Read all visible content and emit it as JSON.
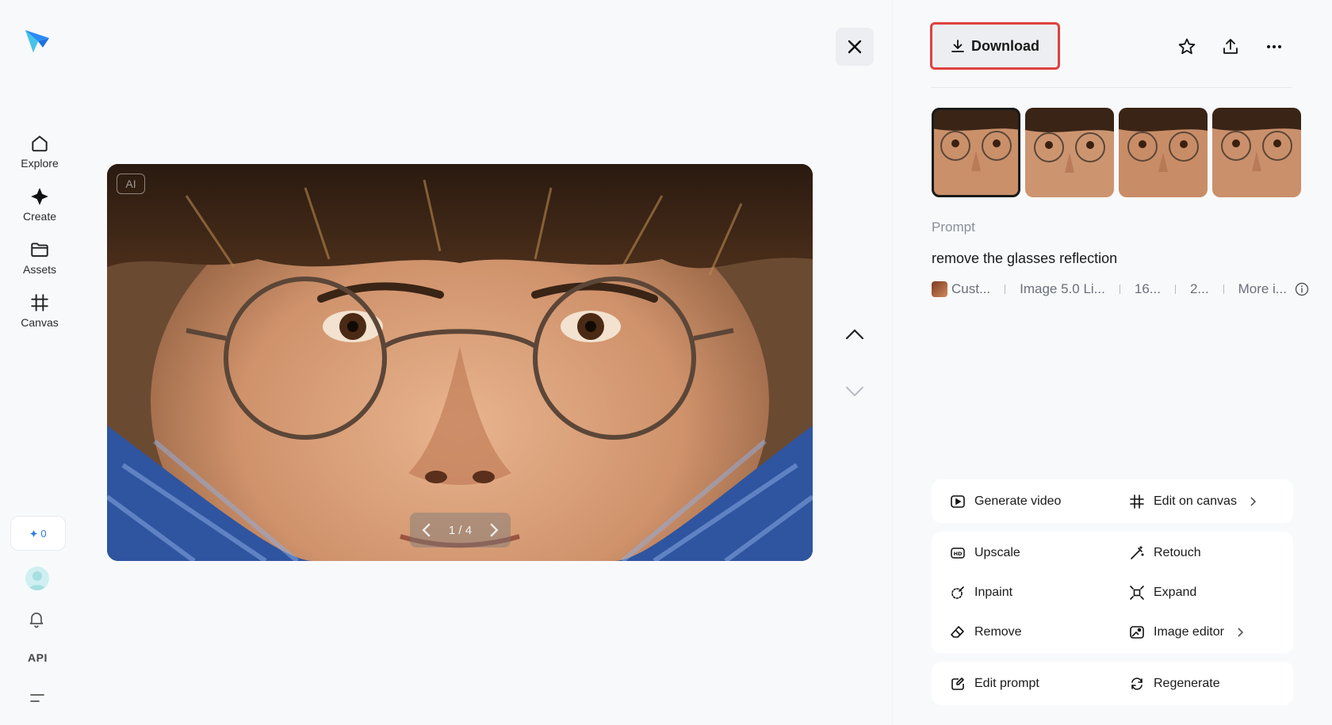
{
  "nav": {
    "items": [
      {
        "label": "Explore",
        "icon": "home-icon"
      },
      {
        "label": "Create",
        "icon": "sparkle-icon"
      },
      {
        "label": "Assets",
        "icon": "folder-icon"
      },
      {
        "label": "Canvas",
        "icon": "canvas-icon"
      }
    ],
    "credits": "0",
    "api_label": "API"
  },
  "viewer": {
    "ai_badge": "AI",
    "pager": {
      "current": "1",
      "separator": "/",
      "total": "4"
    }
  },
  "panel": {
    "download_label": "Download",
    "prompt_label": "Prompt",
    "prompt_text": "remove the glasses reflection",
    "meta": {
      "custom": "Cust...",
      "model": "Image 5.0 Li...",
      "ratio": "16...",
      "res": "2...",
      "more": "More i..."
    },
    "actions": {
      "generate_video": "Generate video",
      "edit_on_canvas": "Edit on canvas",
      "upscale": "Upscale",
      "retouch": "Retouch",
      "inpaint": "Inpaint",
      "expand": "Expand",
      "remove": "Remove",
      "image_editor": "Image editor",
      "edit_prompt": "Edit prompt",
      "regenerate": "Regenerate"
    }
  },
  "colors": {
    "accent": "#2d7bf0",
    "download_outline": "#e0413f",
    "background": "#f8f9fb"
  }
}
